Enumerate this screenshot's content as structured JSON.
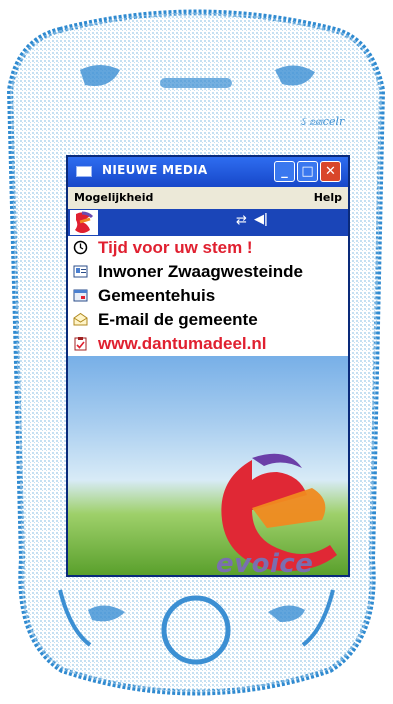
{
  "window": {
    "title": "NIEUWE MEDIA",
    "minimize": "_",
    "maximize": "□",
    "close": "✕"
  },
  "menubar": {
    "left": "Mogelijkheid",
    "right": "Help"
  },
  "toolbar": {
    "connectivity_icon": "⇄",
    "volume_icon": "◀ǀ"
  },
  "device": {
    "brand_label": "ઽ ஊcelr"
  },
  "list": {
    "items": [
      {
        "label": "Tijd voor uw stem !",
        "icon": "clock-icon"
      },
      {
        "label": "Inwoner Zwaagwesteinde",
        "icon": "contact-card-icon"
      },
      {
        "label": "Gemeentehuis",
        "icon": "calendar-icon"
      },
      {
        "label": "E-mail de gemeente",
        "icon": "envelope-icon"
      },
      {
        "label": "www.dantumadeel.nl",
        "icon": "clipboard-icon"
      }
    ]
  },
  "branding": {
    "wordmark": "evoice"
  }
}
